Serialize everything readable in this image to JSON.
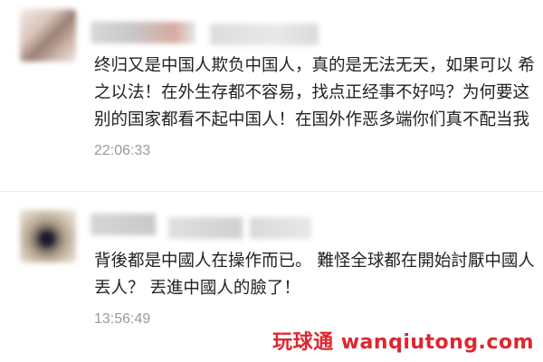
{
  "comments": [
    {
      "lines": [
        "终归又是中国人欺负中国人，真的是无法无天，如果可以 希",
        "之以法！在外生存都不容易，找点正经事不好吗？为何要这",
        "别的国家都看不起中国人！在国外作恶多端你们真不配当我"
      ],
      "time": "22:06:33"
    },
    {
      "lines": [
        "背後都是中國人在操作而已。  難怪全球都在開始討厭中國人",
        "丟人？  丟進中國人的臉了！"
      ],
      "time": "13:56:49"
    }
  ],
  "watermark": "玩球通 wanqiutong.com",
  "colors": {
    "text": "#222222",
    "timestamp": "#9a9a9a",
    "watermark": "#e0262e"
  }
}
